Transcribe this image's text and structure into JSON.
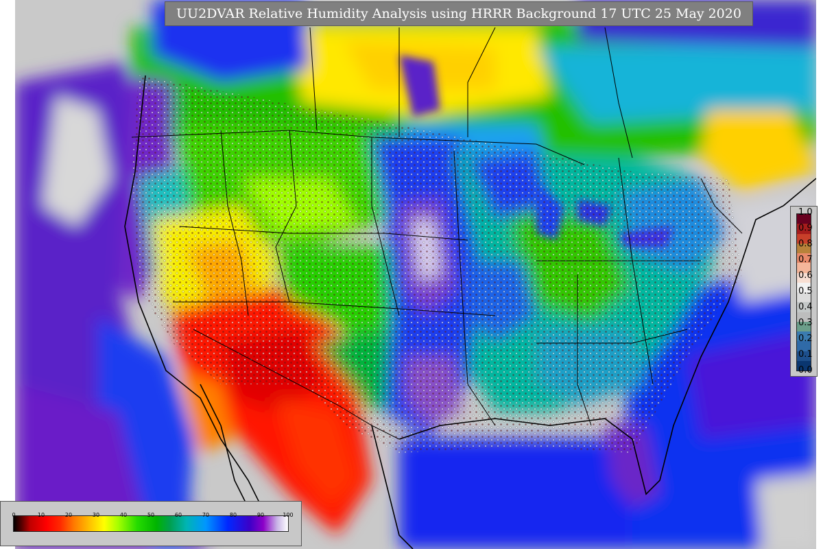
{
  "title": "UU2DVAR Relative Humidity Analysis using HRRR Background 17 UTC 25 May 2020",
  "colors": {
    "background_gray": "#c9c9c9",
    "panel_gray": "#808080",
    "dry_red": "#ff1a00",
    "moist_green": "#22c800",
    "ocean_blue": "#0a2aff",
    "ocean_purple": "#6a1ac8"
  },
  "error_legend": {
    "labels": [
      "1.0",
      "0.9",
      "0.8",
      "0.7",
      "0.6",
      "0.5",
      "0.4",
      "0.3",
      "0.2",
      "0.1",
      "0.0"
    ],
    "swatch_colors": [
      "#67001f",
      "#a51c1c",
      "#c8402a",
      "#b8823a",
      "#e88a6a",
      "#f4b69a",
      "#f7ded2",
      "#f2f2f2",
      "#dcdcdc",
      "#c4c8c8",
      "#bdbdbd",
      "#6b9e8a",
      "#3a7bb0",
      "#2f6aa8",
      "#1d4f8c",
      "#0a3670"
    ]
  },
  "rh_legend": {
    "ticks": [
      "0",
      "10",
      "20",
      "30",
      "40",
      "50",
      "60",
      "70",
      "80",
      "90",
      "100"
    ]
  }
}
